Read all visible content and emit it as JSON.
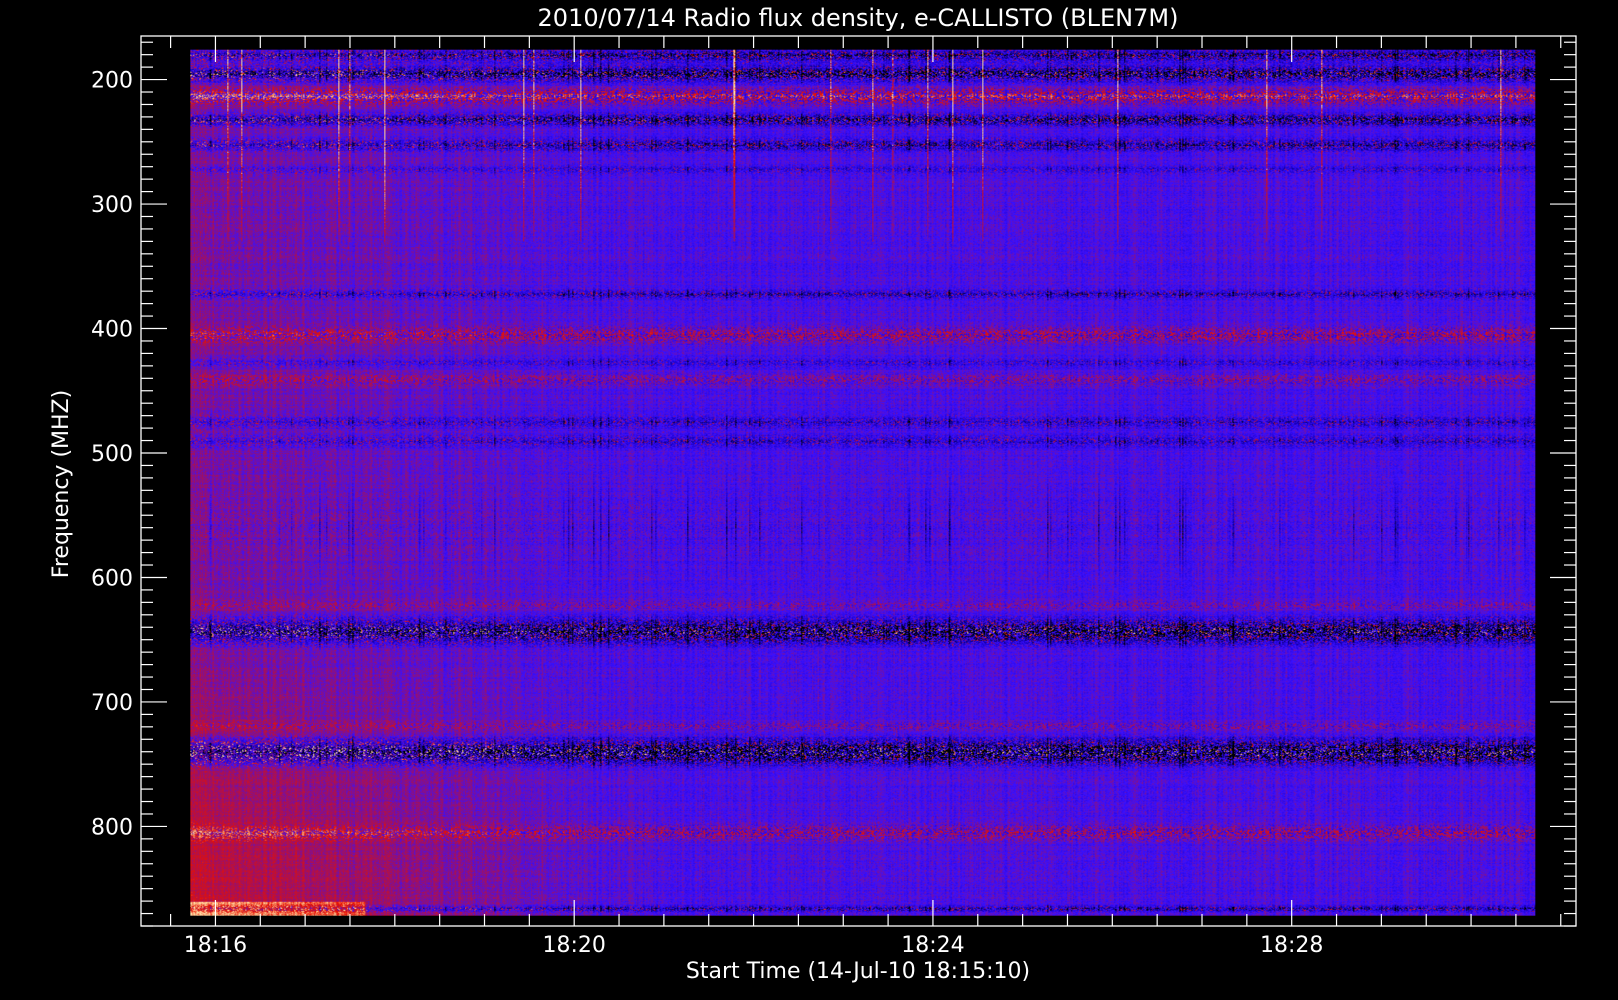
{
  "chart_data": {
    "type": "heatmap",
    "title": "2010/07/14  Radio flux density, e-CALLISTO (BLEN7M)",
    "xlabel": "Start Time (14-Jul-10 18:15:10)",
    "ylabel": "Frequency (MHZ)",
    "x_unit": "minutes after 18:15:10 UT",
    "xlim": [
      0,
      16.0
    ],
    "ylim": [
      880,
      165
    ],
    "data_extent": {
      "x": [
        0.55,
        15.55
      ],
      "y": [
        176,
        872
      ]
    },
    "x_ticks": [
      {
        "value": 0.83,
        "label": "18:16"
      },
      {
        "value": 4.83,
        "label": "18:20"
      },
      {
        "value": 8.83,
        "label": "18:24"
      },
      {
        "value": 12.83,
        "label": "18:28"
      }
    ],
    "y_ticks": [
      200,
      300,
      400,
      500,
      600,
      700,
      800
    ],
    "y_tick_labels": [
      "200",
      "300",
      "400",
      "500",
      "600",
      "700",
      "800"
    ],
    "colormap": [
      "#000000",
      "#1a00c8",
      "#3a10ff",
      "#a01060",
      "#e81000",
      "#ffd8a0"
    ],
    "background_intensity": "reddish (higher) before ~18:21, bluish (lower) afterwards",
    "bands": [
      {
        "f": 180,
        "w": 8,
        "level": 1.55,
        "type": "dark"
      },
      {
        "f": 195,
        "w": 10,
        "level": 1.9,
        "type": "dark"
      },
      {
        "f": 213,
        "w": 10,
        "level": 2.3,
        "type": "rfi"
      },
      {
        "f": 232,
        "w": 8,
        "level": 1.7,
        "type": "dark"
      },
      {
        "f": 252,
        "w": 8,
        "level": 1.4,
        "type": "dark"
      },
      {
        "f": 272,
        "w": 6,
        "level": 0.8,
        "type": "dark"
      },
      {
        "f": 372,
        "w": 6,
        "level": 1.2,
        "type": "dark"
      },
      {
        "f": 405,
        "w": 10,
        "level": 1.7,
        "type": "rfi"
      },
      {
        "f": 427,
        "w": 6,
        "level": 0.8,
        "type": "dark"
      },
      {
        "f": 441,
        "w": 8,
        "level": 1.1,
        "type": "rfi"
      },
      {
        "f": 475,
        "w": 8,
        "level": 1.0,
        "type": "dark"
      },
      {
        "f": 490,
        "w": 8,
        "level": 1.0,
        "type": "dark"
      },
      {
        "f": 560,
        "w": 50,
        "level": 1.0,
        "type": "noisy"
      },
      {
        "f": 622,
        "w": 6,
        "level": 0.9,
        "type": "rfi"
      },
      {
        "f": 643,
        "w": 16,
        "level": 2.0,
        "type": "dark"
      },
      {
        "f": 719,
        "w": 6,
        "level": 1.0,
        "type": "rfi"
      },
      {
        "f": 740,
        "w": 16,
        "level": 2.2,
        "type": "dark"
      },
      {
        "f": 805,
        "w": 10,
        "level": 1.6,
        "type": "rfi"
      },
      {
        "f": 866,
        "w": 4,
        "level": 1.3,
        "type": "dark"
      }
    ]
  }
}
